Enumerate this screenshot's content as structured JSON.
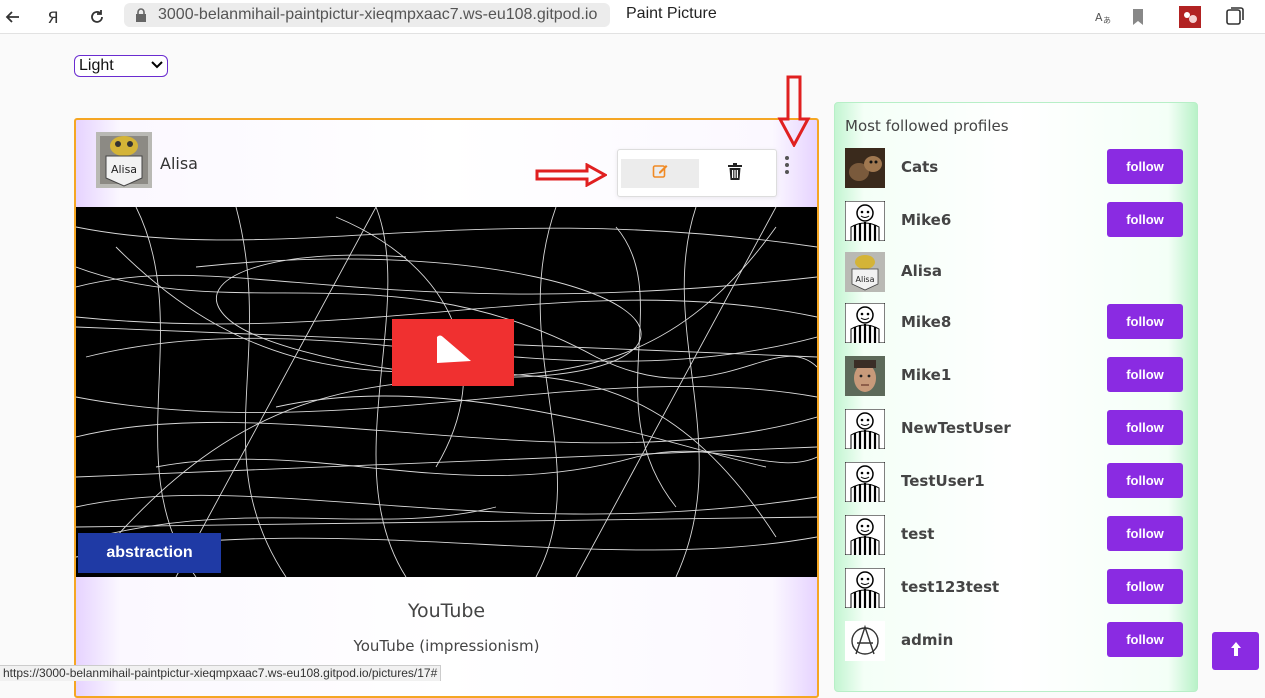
{
  "browser": {
    "url": "3000-belanmihail-paintpictur-xieqmpxaac7.ws-eu108.gitpod.io",
    "tab_title": "Paint Picture",
    "yandex_glyph": "Я",
    "icons": [
      "back-arrow-icon",
      "yandex-icon",
      "reload-icon",
      "lock-icon",
      "translate-icon",
      "bookmark-icon",
      "extension-icon",
      "collections-icon"
    ]
  },
  "theme": {
    "selected": "Light"
  },
  "post": {
    "author": "Alisa",
    "avatar_label": "Alisa",
    "tag": "abstraction",
    "title": "YouTube",
    "subtitle": "YouTube (impressionism)",
    "icons": [
      "kebab-menu-icon",
      "edit-icon",
      "trash-icon",
      "play-icon"
    ]
  },
  "sidebar": {
    "heading": "Most followed profiles",
    "follow_label": "follow",
    "profiles": [
      {
        "name": "Cats",
        "avatar": "cat-photo",
        "follow": true
      },
      {
        "name": "Mike6",
        "avatar": "striped-figure",
        "follow": true
      },
      {
        "name": "Alisa",
        "avatar": "alisa-sign",
        "follow": false
      },
      {
        "name": "Mike8",
        "avatar": "striped-figure",
        "follow": true
      },
      {
        "name": "Mike1",
        "avatar": "face-photo",
        "follow": true
      },
      {
        "name": "NewTestUser",
        "avatar": "striped-figure",
        "follow": true
      },
      {
        "name": "TestUser1",
        "avatar": "striped-figure",
        "follow": true
      },
      {
        "name": "test",
        "avatar": "striped-figure",
        "follow": true
      },
      {
        "name": "test123test",
        "avatar": "striped-figure",
        "follow": true
      },
      {
        "name": "admin",
        "avatar": "anarchy-symbol",
        "follow": true
      }
    ]
  },
  "status_bar": {
    "link": "https://3000-belanmihail-paintpictur-xieqmpxaac7.ws-eu108.gitpod.io/pictures/17#"
  },
  "colors": {
    "accent_purple": "#8a2be2",
    "card_border": "#f5a623",
    "tag_blue": "#1f3aa5",
    "play_red": "#f03030",
    "annotation_red": "#e02020"
  }
}
